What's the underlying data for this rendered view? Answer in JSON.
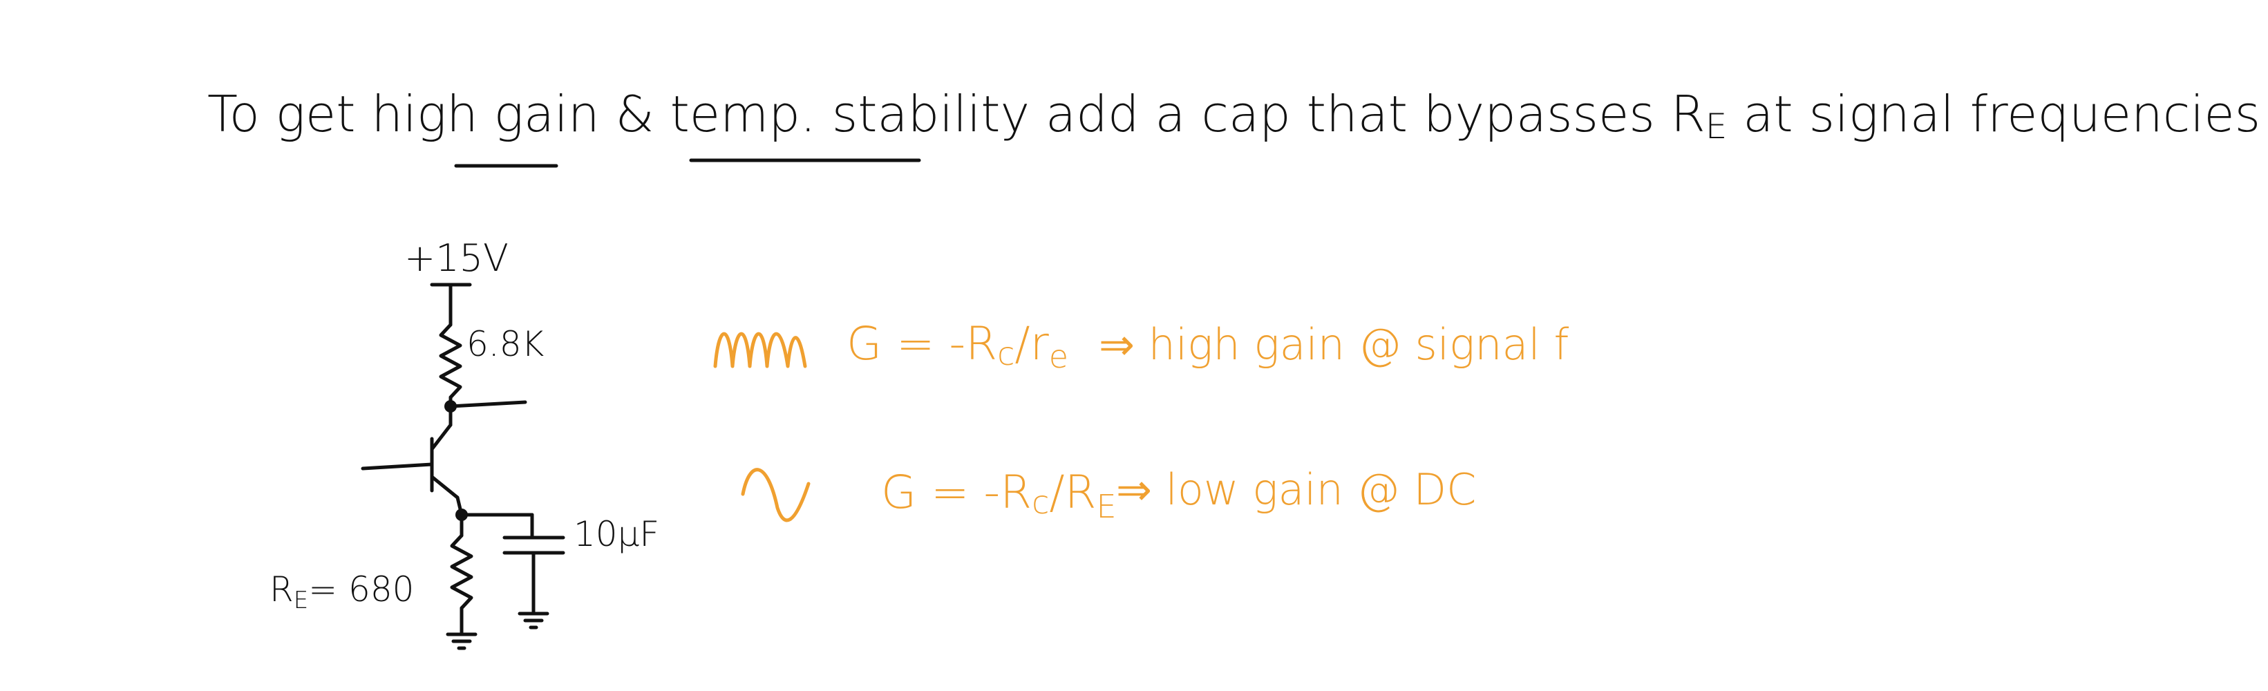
{
  "heading": {
    "part1": "To get ",
    "high_gain": "high gain",
    "part2": " & ",
    "temp_stability": "temp. stability",
    "part3": " add a cap that bypasses R",
    "sub_e": "E",
    "part4": " at signal frequencies"
  },
  "circuit": {
    "supply_label": "+15V",
    "collector_resistor_label": "6.8K",
    "emitter_resistor_label": "R",
    "emitter_resistor_sub": "E",
    "emitter_resistor_value": "= 680",
    "capacitor_label": "10μF"
  },
  "notes": {
    "signal": {
      "gain_prefix": "G = -R",
      "gain_sub_c": "c",
      "gain_slash": "/r",
      "gain_sub_e": "e",
      "result": "⇒ high gain @ signal f"
    },
    "dc": {
      "gain_prefix": "G = -R",
      "gain_sub_c": "c",
      "gain_slash": "/R",
      "gain_sub_e": "E",
      "result": "⇒ low gain @ DC"
    }
  },
  "colors": {
    "ink": "#111111",
    "accent": "#f0a030"
  }
}
